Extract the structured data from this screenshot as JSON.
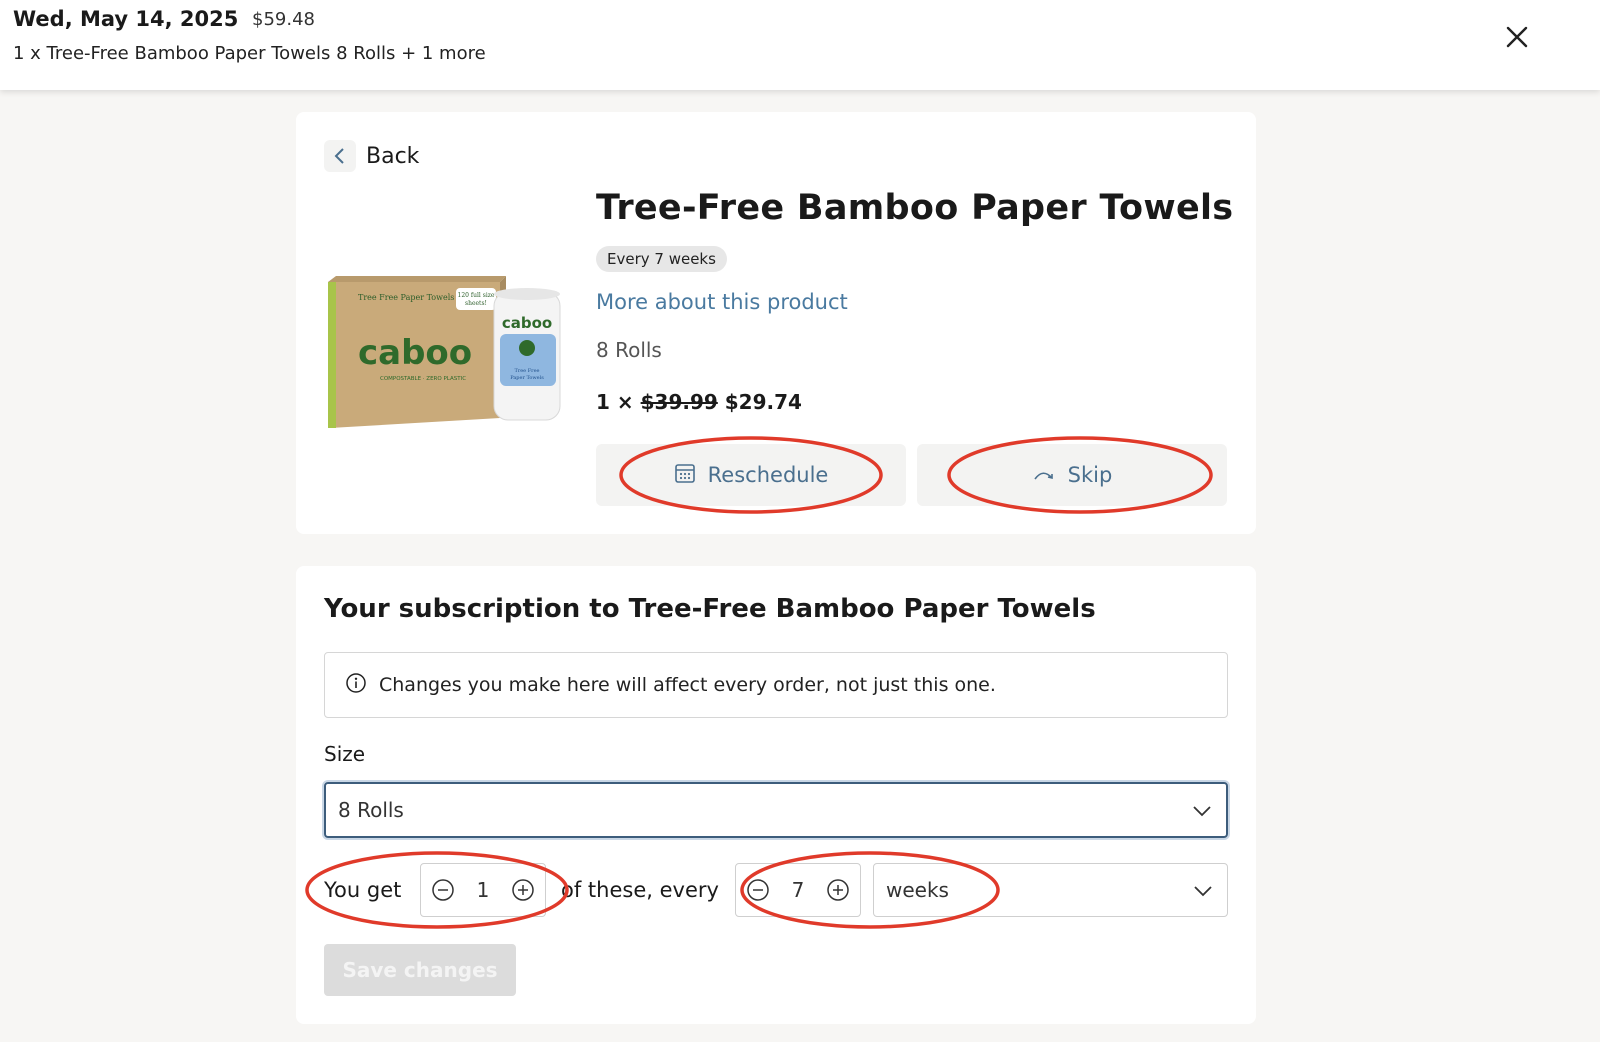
{
  "header": {
    "date": "Wed, May 14, 2025",
    "total": "$59.48",
    "items_summary": "1 x Tree-Free Bamboo Paper Towels 8 Rolls + 1 more"
  },
  "product": {
    "back_label": "Back",
    "title": "Tree-Free Bamboo Paper Towels",
    "frequency_pill": "Every 7 weeks",
    "more_link": "More about this product",
    "size": "8 Rolls",
    "quantity_prefix": "1 ×",
    "original_price": "$39.99",
    "price": "$29.74",
    "reschedule_label": "Reschedule",
    "skip_label": "Skip",
    "image": {
      "box_title": "Tree Free Paper Towels",
      "box_badge": "120 full size sheets!",
      "brand": "caboo",
      "box_tagline": "COMPOSTABLE · ZERO PLASTIC",
      "roll_label": "Tree Free Paper Towels"
    }
  },
  "subscription": {
    "title": "Your subscription to Tree-Free Bamboo Paper Towels",
    "info_text": "Changes you make here will affect every order, not just this one.",
    "size_label": "Size",
    "size_value": "8 Rolls",
    "you_get_label": "You get",
    "quantity": "1",
    "of_these_label": "of these, every",
    "frequency": "7",
    "unit": "weeks",
    "save_label": "Save changes"
  },
  "colors": {
    "accent_link": "#4a7aa0",
    "annotation_red": "#e03a2a",
    "focus_border": "#3d5d7c"
  }
}
